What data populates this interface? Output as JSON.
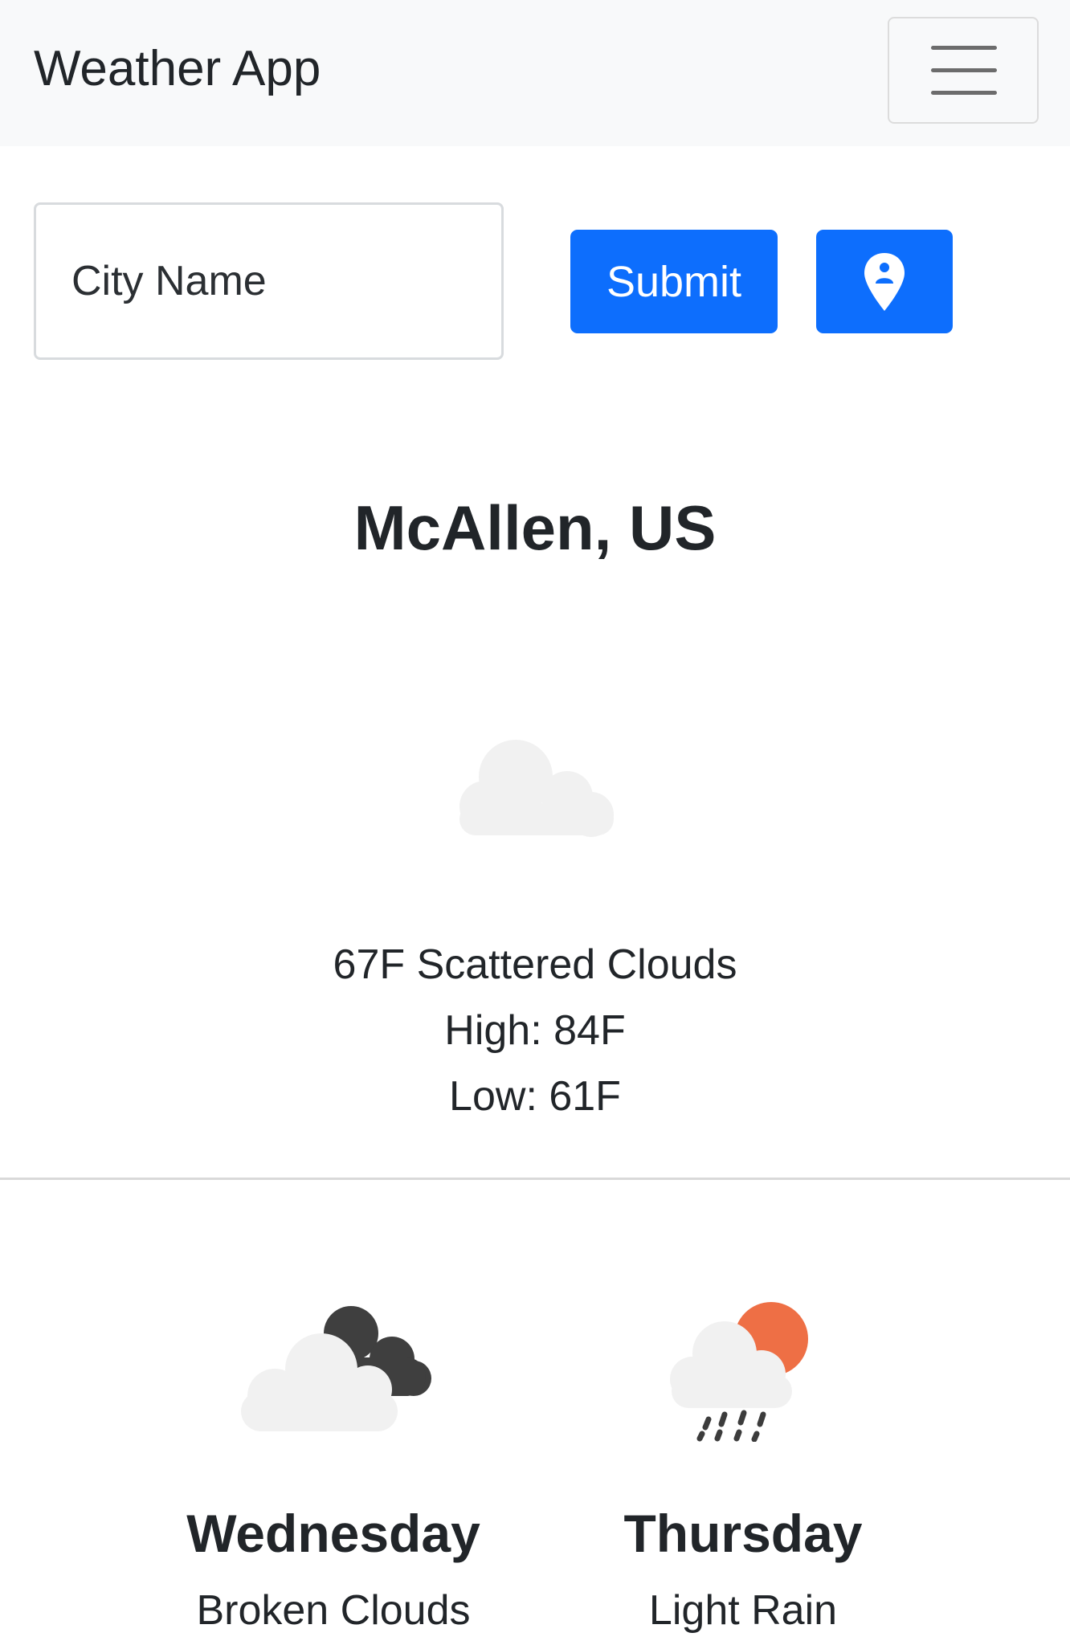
{
  "navbar": {
    "brand": "Weather App"
  },
  "search": {
    "placeholder": "City Name",
    "value": "",
    "submit_label": "Submit"
  },
  "current": {
    "location": "McAllen, US",
    "summary": "67F Scattered Clouds",
    "high": "High: 84F",
    "low": "Low: 61F",
    "icon": "scattered-clouds-icon"
  },
  "forecast": [
    {
      "day": "Wednesday",
      "description": "Broken Clouds",
      "icon": "broken-clouds-icon"
    },
    {
      "day": "Thursday",
      "description": "Light Rain",
      "icon": "light-rain-icon"
    }
  ],
  "colors": {
    "primary": "#0d6efd",
    "navbar_bg": "#f8f9fa",
    "sun": "#ee6f45",
    "dark_cloud": "#3f3f3f",
    "light_cloud": "#f1f1f1"
  }
}
